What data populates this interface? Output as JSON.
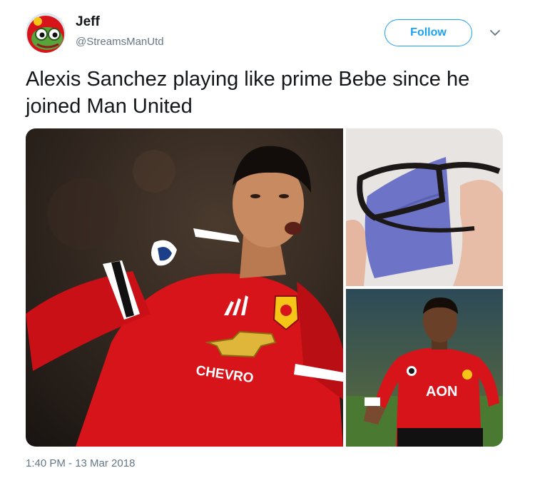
{
  "user": {
    "display_name": "Jeff",
    "handle": "@StreamsManUtd",
    "avatar_icon": "frog-avatar-icon"
  },
  "actions": {
    "follow_label": "Follow",
    "more_icon": "chevron-down-icon"
  },
  "tweet": {
    "text": "Alexis Sanchez playing like prime Bebe since he joined Man United",
    "timestamp": "1:40 PM - 13 Mar 2018"
  },
  "media": {
    "image_count": 3,
    "jersey_sponsor_main": "CHEVRO",
    "jersey_sponsor_small": "AON"
  },
  "colors": {
    "accent": "#1da1f2",
    "secondary_text": "#657786",
    "kit_red": "#d8141b"
  }
}
